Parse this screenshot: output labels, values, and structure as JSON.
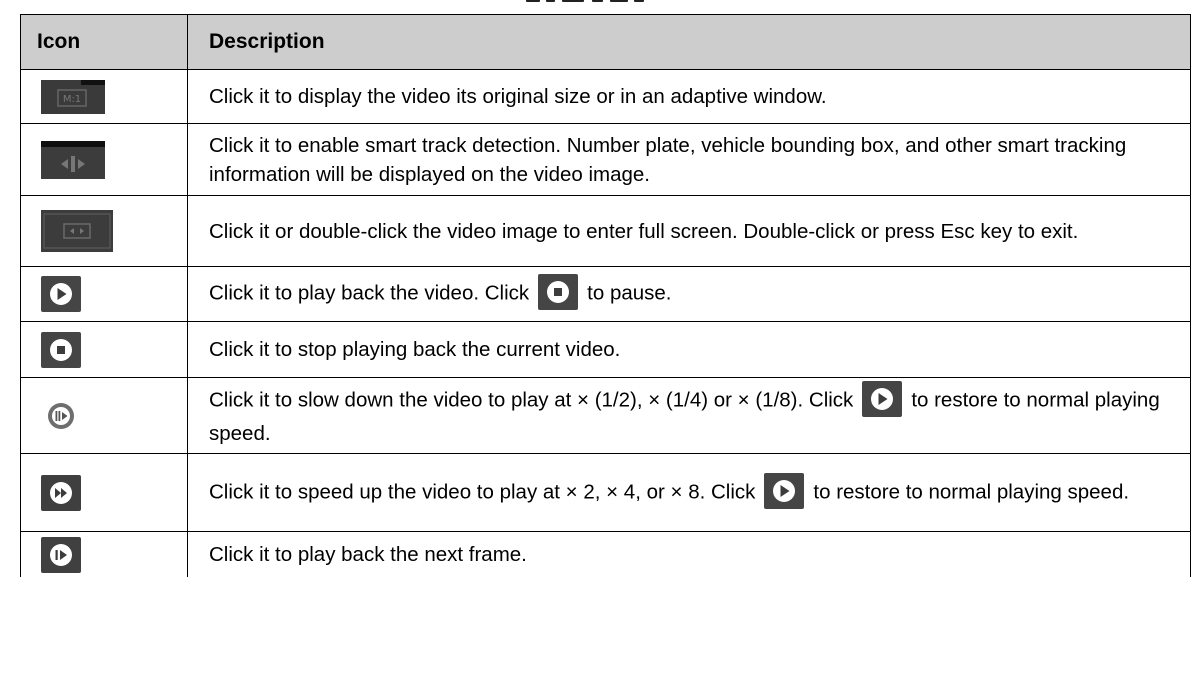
{
  "table": {
    "headers": {
      "icon": "Icon",
      "description": "Description"
    },
    "rows": [
      {
        "icon": "original-size-icon",
        "text": "Click it to display the video its original size or in an adaptive window."
      },
      {
        "icon": "smart-track-icon",
        "text": "Click it to enable smart track detection. Number plate, vehicle bounding box, and other smart tracking information will be displayed on the video image."
      },
      {
        "icon": "full-screen-icon",
        "text": "Click it or double-click the video image to enter full screen. Double-click or press Esc key to exit."
      },
      {
        "icon": "play-icon",
        "text_before": "Click it to play back the video. Click",
        "inline_icon": "pause-icon",
        "text_after": "to pause."
      },
      {
        "icon": "stop-icon",
        "text": "Click it to stop playing back the current video."
      },
      {
        "icon": "slow-play-icon",
        "text_before": "Click it to slow down the video to play at × (1/2), × (1/4) or × (1/8). Click",
        "inline_icon": "play-icon",
        "text_after": "to restore to normal playing speed."
      },
      {
        "icon": "fast-play-icon",
        "text_before": "Click it to speed up the video to play at × 2, × 4, or × 8. Click",
        "inline_icon": "play-icon",
        "text_after": "to restore to normal playing speed."
      },
      {
        "icon": "next-frame-icon",
        "text": "Click it to play back the next frame."
      }
    ]
  },
  "colors": {
    "header_bg": "#cdcdcd",
    "border": "#000000",
    "icon_dark": "#3c3c3c",
    "icon_gray": "#777777"
  }
}
